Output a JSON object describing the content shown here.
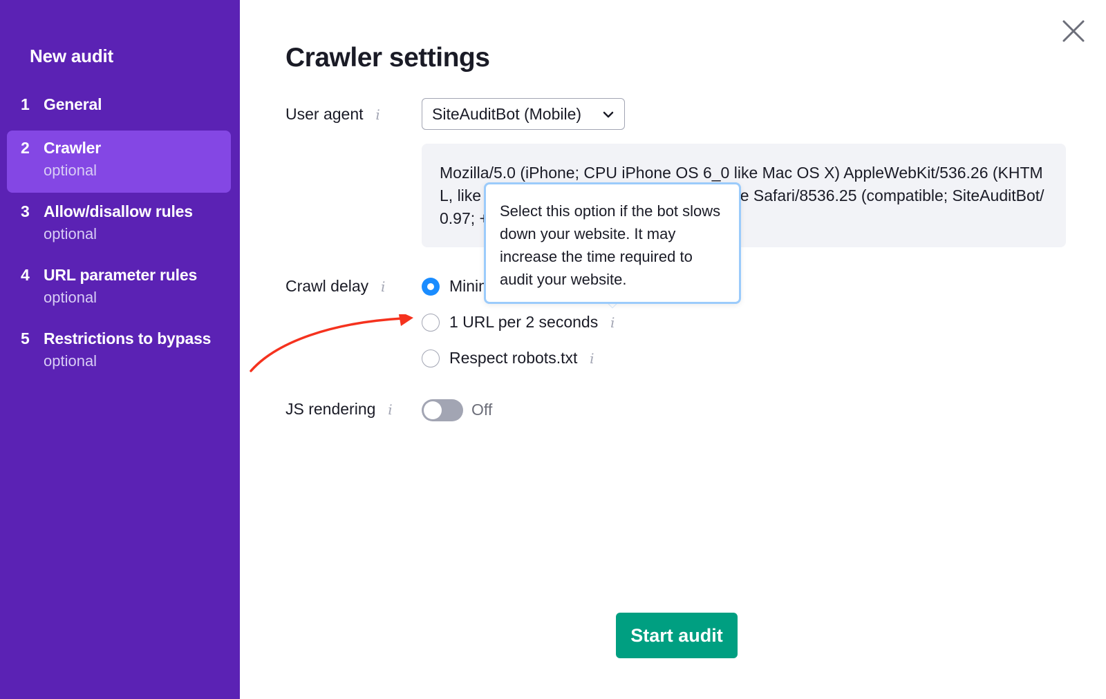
{
  "sidebar": {
    "title": "New audit",
    "steps": [
      {
        "num": "1",
        "label": "General",
        "sub": ""
      },
      {
        "num": "2",
        "label": "Crawler",
        "sub": "optional"
      },
      {
        "num": "3",
        "label": "Allow/disallow rules",
        "sub": "optional"
      },
      {
        "num": "4",
        "label": "URL parameter rules",
        "sub": "optional"
      },
      {
        "num": "5",
        "label": "Restrictions to bypass",
        "sub": "optional"
      }
    ]
  },
  "main": {
    "title": "Crawler settings",
    "user_agent": {
      "label": "User agent",
      "selected": "SiteAuditBot (Mobile)",
      "string": "Mozilla/5.0 (iPhone; CPU iPhone OS 6_0 like Mac OS X) AppleWebKit/536.26 (KHTML, like Gecko) Version/6.0 Mobile/10A5376e Safari/8536.25 (compatible; SiteAuditBot/0.97; +http://www.semrush.com/bot.html)"
    },
    "crawl_delay": {
      "label": "Crawl delay",
      "options": [
        {
          "label": "Minimum delay",
          "checked": true
        },
        {
          "label": "1 URL per 2 seconds",
          "checked": false
        },
        {
          "label": "Respect robots.txt",
          "checked": false
        }
      ]
    },
    "js_rendering": {
      "label": "JS rendering",
      "state": "Off"
    },
    "tooltip": "Select this option if the bot slows down your website. It may increase the time required to audit your website.",
    "start_button": "Start audit"
  },
  "colors": {
    "sidebar_bg": "#5b22b4",
    "active_step_bg": "#8447e4",
    "primary_button": "#009f81",
    "radio_checked": "#1a8cff",
    "annotation_arrow": "#f5321e"
  },
  "icons": {
    "close": "close-icon",
    "dropdown": "chevron-down-icon",
    "info": "info-icon"
  }
}
